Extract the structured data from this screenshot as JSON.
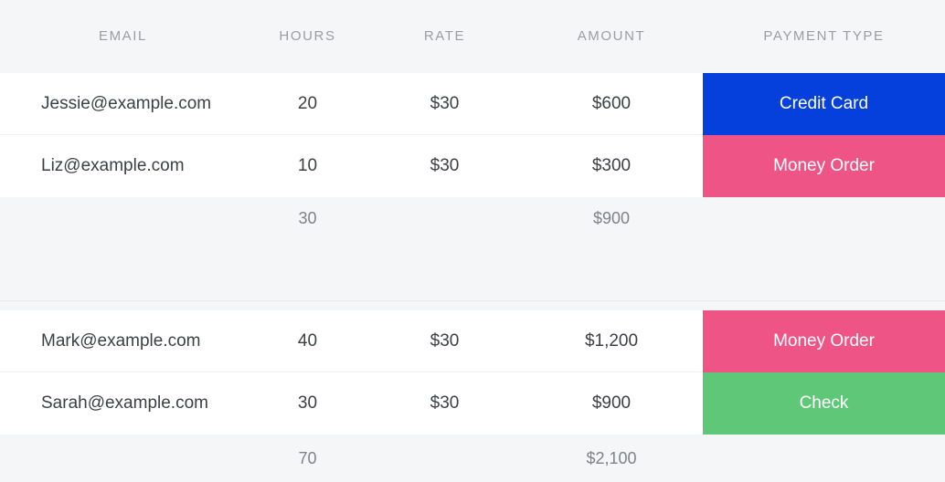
{
  "table": {
    "columns": [
      {
        "key": "email",
        "label": "EMAIL"
      },
      {
        "key": "hours",
        "label": "HOURS"
      },
      {
        "key": "rate",
        "label": "RATE"
      },
      {
        "key": "amount",
        "label": "AMOUNT"
      },
      {
        "key": "payment_type",
        "label": "PAYMENT TYPE"
      }
    ],
    "groups": [
      {
        "rows": [
          {
            "email": "Jessie@example.com",
            "hours": "20",
            "rate": "$30",
            "amount": "$600",
            "payment_type": "Credit Card",
            "payment_color": "#0540dc"
          },
          {
            "email": "Liz@example.com",
            "hours": "10",
            "rate": "$30",
            "amount": "$300",
            "payment_type": "Money Order",
            "payment_color": "#ee5586"
          }
        ],
        "subtotal": {
          "email": "",
          "hours": "30",
          "rate": "",
          "amount": "$900",
          "payment_type": ""
        }
      },
      {
        "rows": [
          {
            "email": "Mark@example.com",
            "hours": "40",
            "rate": "$30",
            "amount": "$1,200",
            "payment_type": "Money Order",
            "payment_color": "#ee5586"
          },
          {
            "email": "Sarah@example.com",
            "hours": "30",
            "rate": "$30",
            "amount": "$900",
            "payment_type": "Check",
            "payment_color": "#5fc878"
          }
        ],
        "subtotal": {
          "email": "",
          "hours": "70",
          "rate": "",
          "amount": "$2,100",
          "payment_type": ""
        }
      }
    ]
  },
  "colors": {
    "page_background": "#ffffff",
    "band_background": "#f5f6f8",
    "row_background": "#ffffff",
    "row_divider": "#eef0f3",
    "header_text": "#9b9da4",
    "cell_text": "#3c3f45",
    "subtotal_text": "#7f8289",
    "credit_card": "#0540dc",
    "money_order": "#ee5586",
    "check": "#5fc878"
  }
}
